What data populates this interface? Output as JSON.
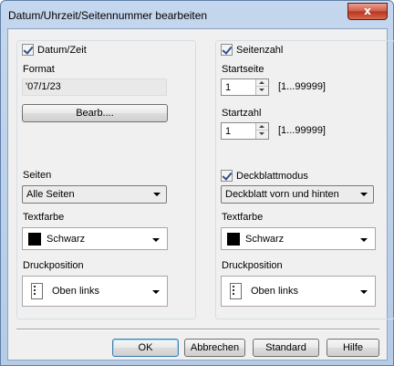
{
  "window": {
    "title": "Datum/Uhrzeit/Seitennummer bearbeiten",
    "close_label": "x"
  },
  "left": {
    "checkbox_label": "Datum/Zeit",
    "checked": true,
    "format_label": "Format",
    "format_value": "'07/1/23",
    "edit_button": "Bearb....",
    "pages_label": "Seiten",
    "pages_value": "Alle Seiten",
    "textcolor_label": "Textfarbe",
    "textcolor_value": "Schwarz",
    "textcolor_hex": "#000000",
    "printpos_label": "Druckposition",
    "printpos_value": "Oben links"
  },
  "right": {
    "checkbox_label": "Seitenzahl",
    "checked": true,
    "startpage_label": "Startseite",
    "startpage_value": "1",
    "startpage_range": "[1...99999]",
    "startnum_label": "Startzahl",
    "startnum_value": "1",
    "startnum_range": "[1...99999]",
    "cover_label": "Deckblattmodus",
    "cover_checked": true,
    "cover_value": "Deckblatt vorn und hinten",
    "textcolor_label": "Textfarbe",
    "textcolor_value": "Schwarz",
    "textcolor_hex": "#000000",
    "printpos_label": "Druckposition",
    "printpos_value": "Oben links"
  },
  "footer": {
    "ok": "OK",
    "cancel": "Abbrechen",
    "standard": "Standard",
    "help": "Hilfe"
  }
}
